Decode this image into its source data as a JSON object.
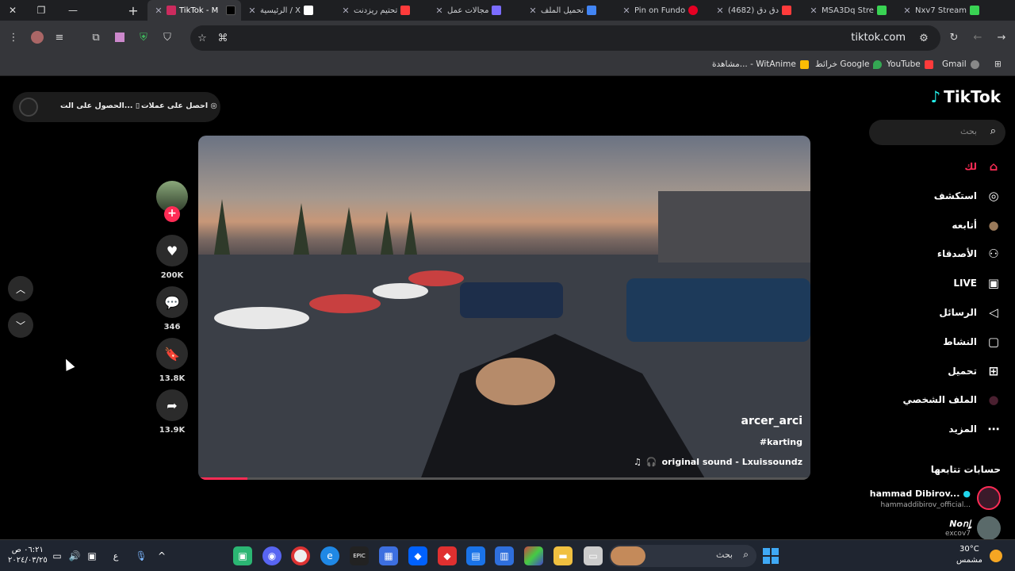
{
  "browser": {
    "tabs": [
      {
        "title": "Nxv7 Stream",
        "color": "#39d353"
      },
      {
        "title": "MSA3Dq Stre",
        "color": "#39d353"
      },
      {
        "title": "(4682) دق دق",
        "color": "#ff3b3b"
      },
      {
        "title": "Pin on Fundo",
        "color": "#e60023"
      },
      {
        "title": "تحميل الملف",
        "color": "#4285f4"
      },
      {
        "title": "مجالات عمل",
        "color": "#7b6cff"
      },
      {
        "title": "تحتيم ريزدنت",
        "color": "#ff3b3b"
      },
      {
        "title": "الرئيسية / X",
        "color": "#ffffff"
      },
      {
        "title": "TikTok - M",
        "color": "#111111"
      }
    ],
    "url": "tiktok.com",
    "bookmarks": [
      "Gmail",
      "YouTube",
      "خرائط Google",
      "مشاهدة... - WitAnime"
    ]
  },
  "tiktok": {
    "logo": "TikTok",
    "search_placeholder": "بحث",
    "nav": [
      {
        "label": "لك",
        "icon": "home-icon"
      },
      {
        "label": "استكشف",
        "icon": "compass-icon"
      },
      {
        "label": "أتابعه",
        "icon": "following-avatar-icon"
      },
      {
        "label": "الأصدقاء",
        "icon": "friends-icon"
      },
      {
        "label": "LIVE",
        "icon": "live-icon"
      },
      {
        "label": "الرسائل",
        "icon": "messages-icon"
      },
      {
        "label": "النشاط",
        "icon": "activity-icon"
      },
      {
        "label": "تحميل",
        "icon": "upload-icon"
      },
      {
        "label": "الملف الشخصي",
        "icon": "profile-icon"
      },
      {
        "label": "المزيد",
        "icon": "more-icon"
      }
    ],
    "following_title": "حسابات تتابعها",
    "following_accounts": [
      {
        "name": "hammad Dibirov...",
        "handle": "hammaddibirov_official...",
        "verified": true
      },
      {
        "name": "Nonٍإ",
        "handle": "excov7",
        "verified": false
      }
    ],
    "promo": {
      "coins": "احصل على عملات",
      "app": "الحصول على الت..."
    },
    "video": {
      "author": "arcer_arci",
      "hashtag": "#karting",
      "sound": "original sound - Lxuissoundz",
      "progress": 0.08
    },
    "actions": {
      "likes": "200K",
      "comments": "346",
      "saves": "13.8K",
      "shares": "13.9K"
    }
  },
  "taskbar": {
    "search": "بحث",
    "weather_temp": "30°C",
    "weather_desc": "مشمس",
    "time": "٠٦:٢١ ص",
    "date": "٢٠٢٤/٠٣/٢٥",
    "lang": "ع"
  }
}
